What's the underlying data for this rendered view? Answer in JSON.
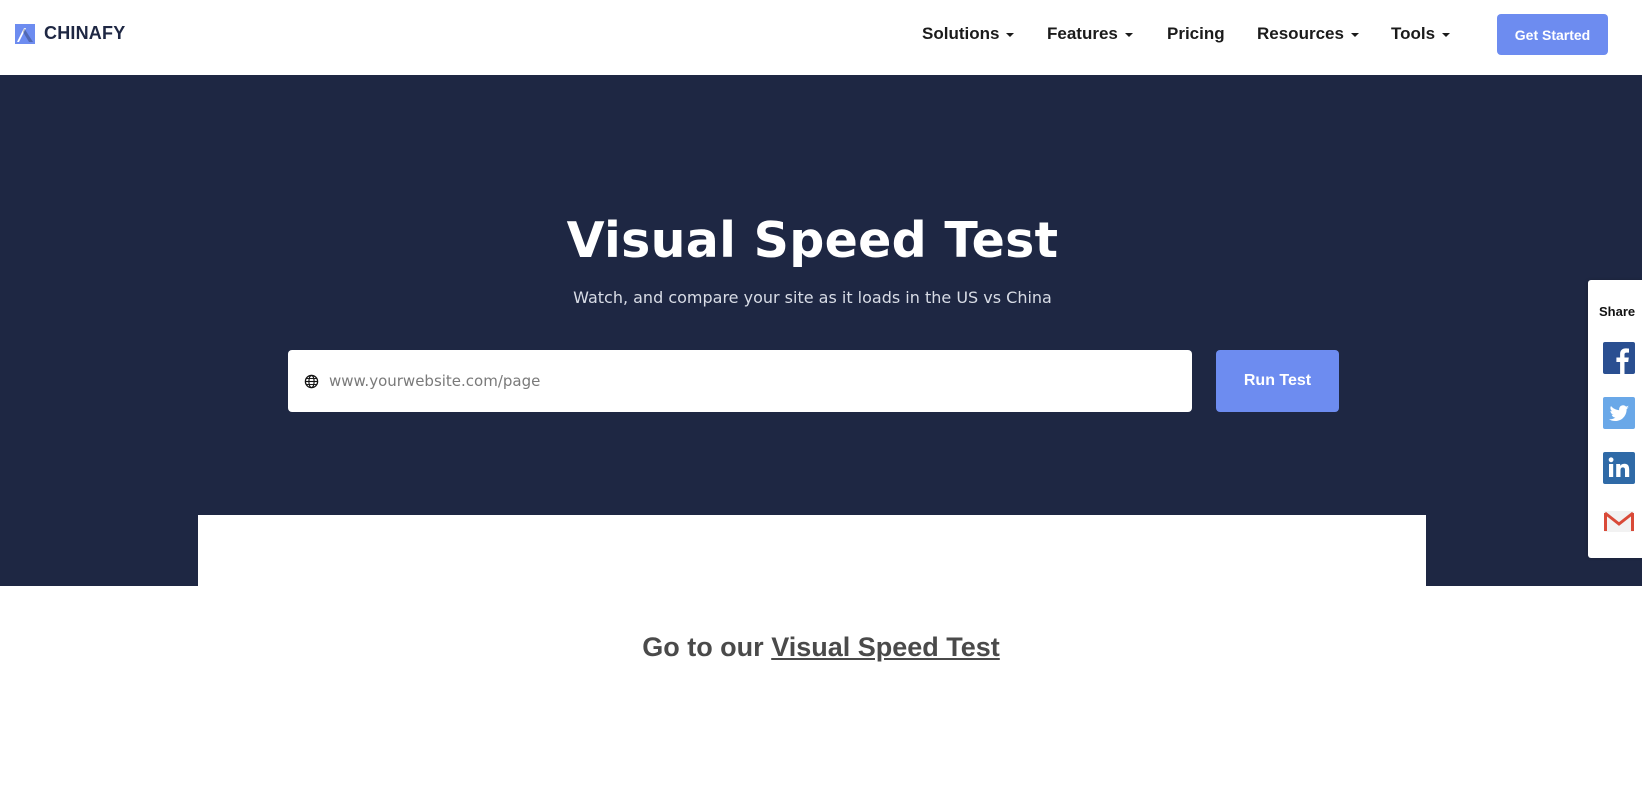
{
  "brand": {
    "name": "CHINAFY",
    "accent": "#6d8cf0",
    "navy": "#1e2743"
  },
  "nav": {
    "items": [
      {
        "label": "Solutions",
        "dropdown": true
      },
      {
        "label": "Features",
        "dropdown": true
      },
      {
        "label": "Pricing",
        "dropdown": false
      },
      {
        "label": "Resources",
        "dropdown": true
      },
      {
        "label": "Tools",
        "dropdown": true
      }
    ],
    "cta_label": "Get Started"
  },
  "hero": {
    "title": "Visual Speed Test",
    "subtitle": "Watch, and compare your site as it loads in the US vs China",
    "url_placeholder": "www.yourwebsite.com/page",
    "url_value": "",
    "run_label": "Run Test"
  },
  "cta_text": {
    "prefix": "Go to our",
    "link": "Visual Speed Test"
  },
  "share": {
    "label": "Share",
    "icons": [
      "facebook-icon",
      "twitter-icon",
      "linkedin-icon",
      "gmail-icon"
    ]
  }
}
